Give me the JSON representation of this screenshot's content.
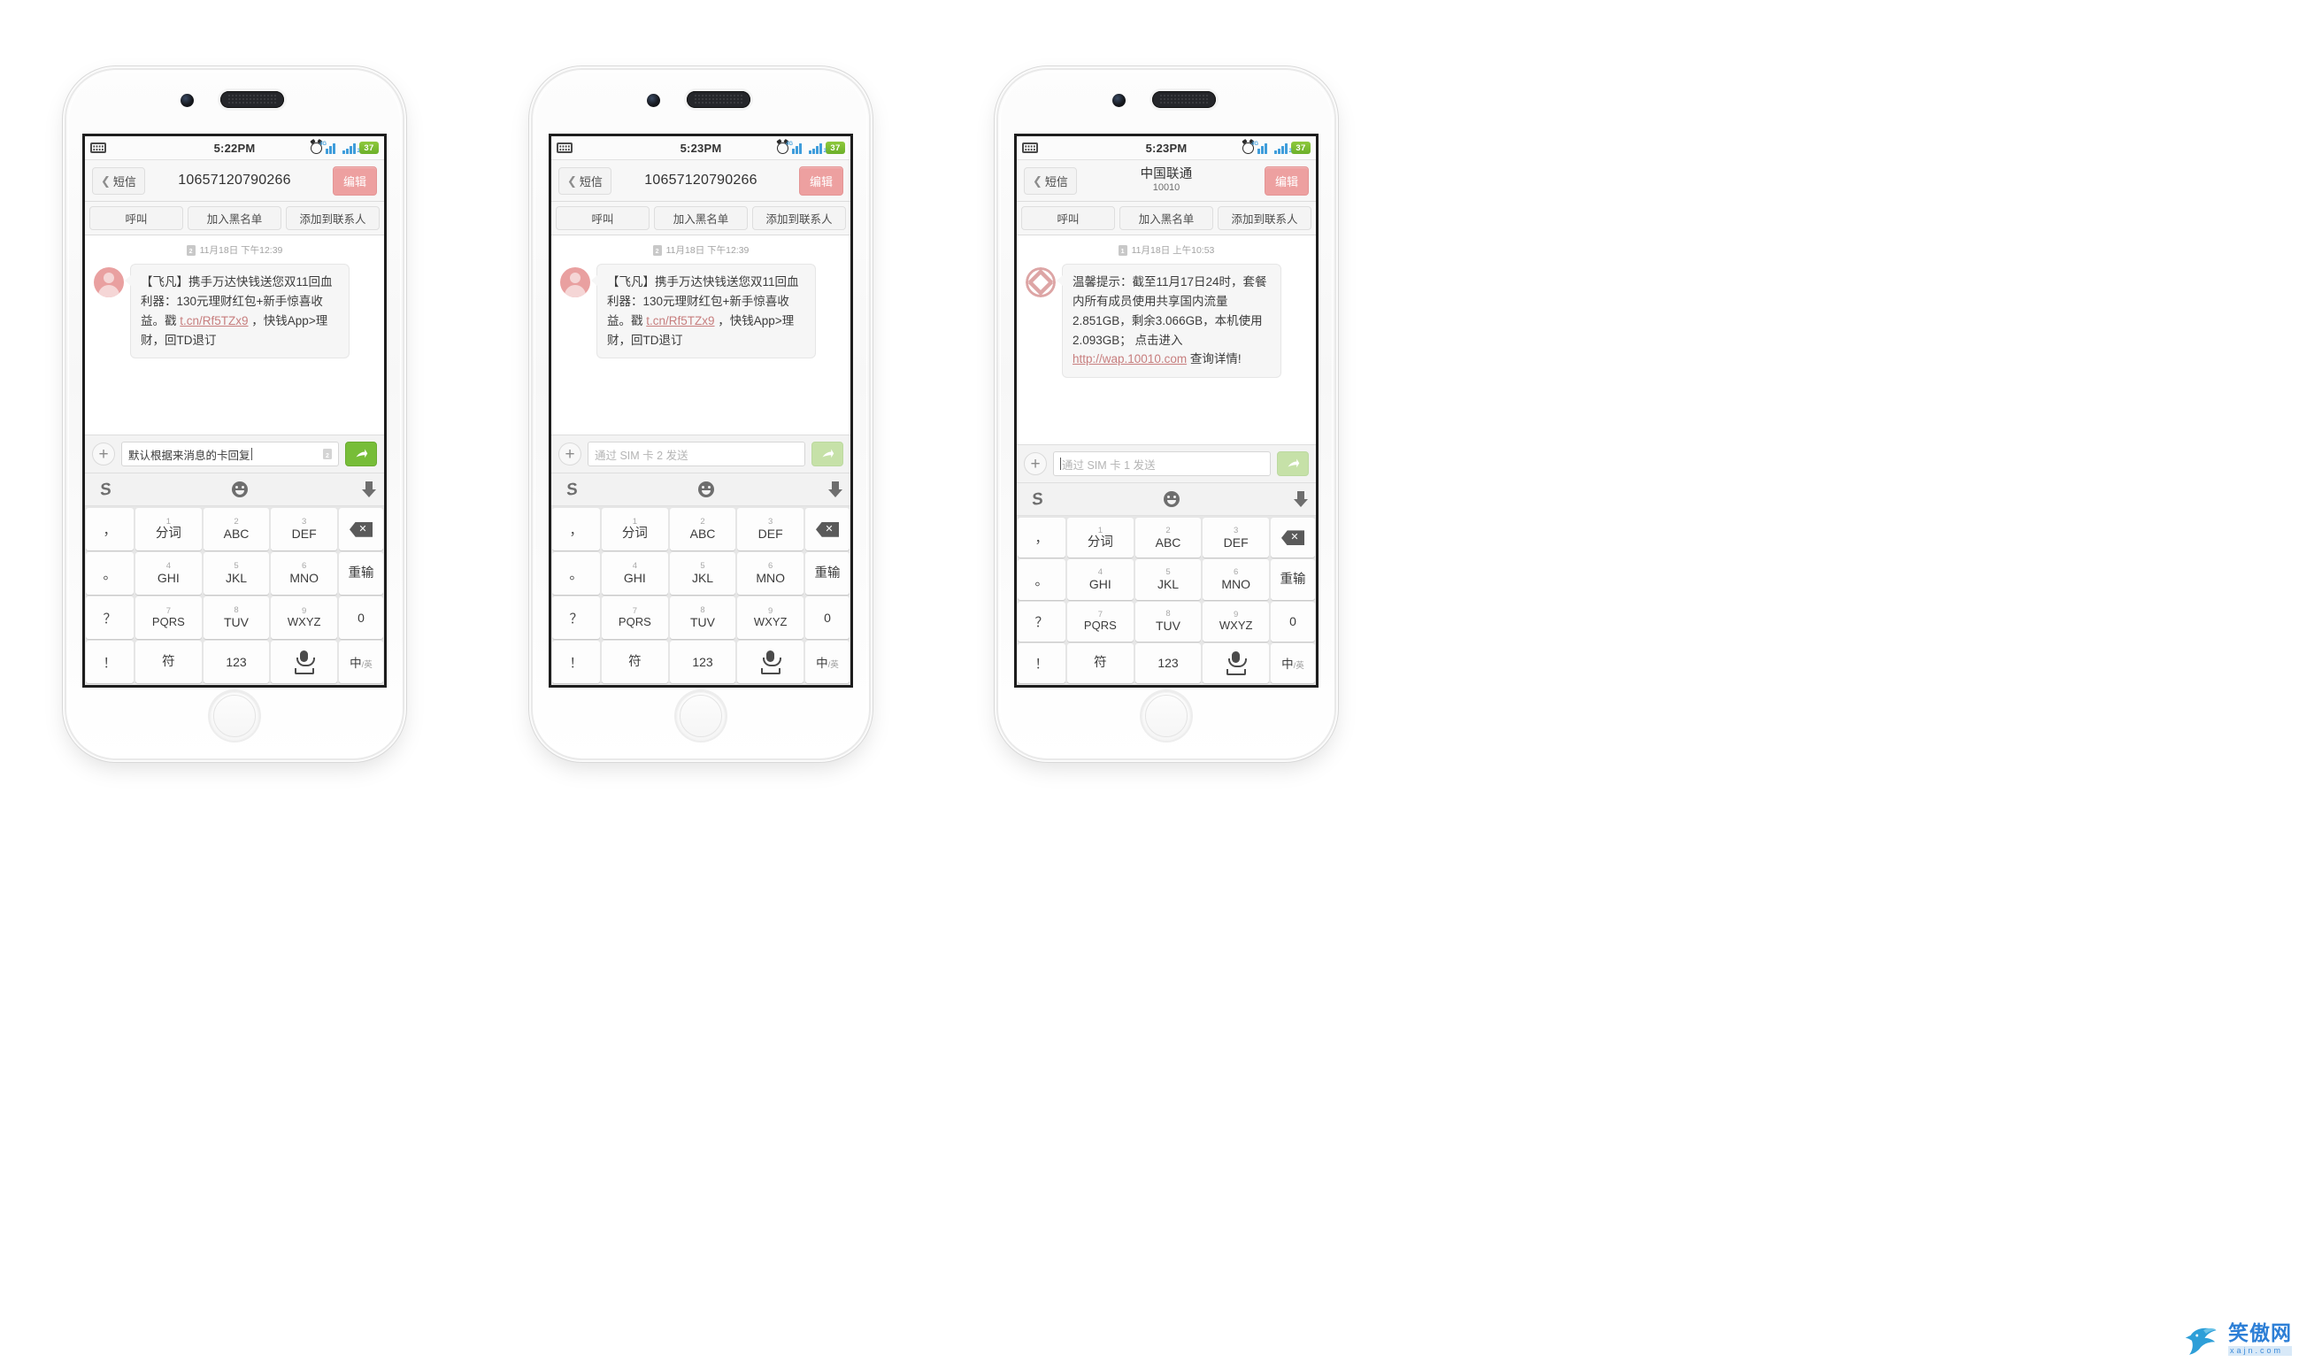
{
  "page": {
    "background": "#ffffff",
    "accent_green": "#77bd38",
    "accent_pink": "#eda0a0",
    "link_color": "#c77e7e"
  },
  "watermark": {
    "cn": "笑傲网",
    "en": "xajn.com",
    "logo_icon": "shark-logo-icon"
  },
  "common": {
    "statusbar": {
      "keyboard_icon": "keyboard-icon",
      "alarm_icon": "alarm-clock-icon",
      "signal1_icon": "signal-bars-4g-icon",
      "signal1_tag": "4G",
      "signal2_icon": "signal-bars-sim2-icon",
      "signal2_tag": "2",
      "battery_level": "37"
    },
    "navbar": {
      "back_label": "短信",
      "back_icon": "chevron-left-icon",
      "edit_label": "编辑"
    },
    "actions": [
      "呼叫",
      "加入黑名单",
      "添加到联系人"
    ],
    "composer": {
      "plus_icon": "plus-icon",
      "send_icon": "send-arrow-icon",
      "sim_badge_icon": "sim-card-icon"
    },
    "kbtop": {
      "ime_icon": "sogou-ime-icon",
      "emoji_icon": "smiley-icon",
      "hide_icon": "arrow-down-icon"
    },
    "keyboard": {
      "punct_keys": [
        "，",
        "。",
        "？",
        "！"
      ],
      "rows": [
        [
          {
            "num": "1",
            "label": "分词"
          },
          {
            "num": "2",
            "label": "ABC"
          },
          {
            "num": "3",
            "label": "DEF"
          }
        ],
        [
          {
            "num": "4",
            "label": "GHI"
          },
          {
            "num": "5",
            "label": "JKL"
          },
          {
            "num": "6",
            "label": "MNO"
          }
        ],
        [
          {
            "num": "7",
            "label": "PQRS"
          },
          {
            "num": "8",
            "label": "TUV"
          },
          {
            "num": "9",
            "label": "WXYZ"
          }
        ]
      ],
      "right_col": [
        {
          "label": "",
          "icon": "backspace-icon"
        },
        {
          "label": "重输",
          "icon": ""
        },
        {
          "label": "0",
          "icon": ""
        }
      ],
      "bottom_row": [
        {
          "label": "符",
          "icon": ""
        },
        {
          "label": "123",
          "icon": ""
        },
        {
          "label": "",
          "icon": "microphone-space-icon"
        },
        {
          "label": "中",
          "sub": "/英",
          "icon": ""
        },
        {
          "label": "",
          "icon": "enter-icon"
        }
      ]
    }
  },
  "phones": [
    {
      "id": "phone-1",
      "time": "5:22PM",
      "title": "10657120790266",
      "subtitle": "",
      "date_label": "11月18日 下午12:39",
      "date_sim": "2",
      "avatar": "person-avatar",
      "message": {
        "part1": "【飞凡】携手万达快钱送您双11回血利器：130元理财红包+新手惊喜收益。戳 ",
        "link": "t.cn/Rf5TZx9",
        "part2": " ，快钱App>理财，回TD退订"
      },
      "input_value": "默认根据来消息的卡回复",
      "input_placeholder": "",
      "input_sim_badge": "2",
      "send_enabled": true
    },
    {
      "id": "phone-2",
      "time": "5:23PM",
      "title": "10657120790266",
      "subtitle": "",
      "date_label": "11月18日 下午12:39",
      "date_sim": "2",
      "avatar": "person-avatar",
      "message": {
        "part1": "【飞凡】携手万达快钱送您双11回血利器：130元理财红包+新手惊喜收益。戳 ",
        "link": "t.cn/Rf5TZx9",
        "part2": " ，快钱App>理财，回TD退订"
      },
      "input_value": "",
      "input_placeholder": "通过 SIM 卡 2 发送",
      "input_sim_badge": "",
      "send_enabled": false
    },
    {
      "id": "phone-3",
      "time": "5:23PM",
      "title": "中国联通",
      "subtitle": "10010",
      "date_label": "11月18日 上午10:53",
      "date_sim": "1",
      "avatar": "china-unicom-logo",
      "message": {
        "part1": "温馨提示：截至11月17日24时，套餐内所有成员使用共享国内流量2.851GB，剩余3.066GB，本机使用2.093GB； 点击进入 ",
        "link": "http://wap.10010.com",
        "part2": " 查询详情!"
      },
      "input_value": "",
      "input_placeholder": "通过 SIM 卡 1 发送",
      "input_sim_badge": "",
      "send_enabled": false
    }
  ]
}
